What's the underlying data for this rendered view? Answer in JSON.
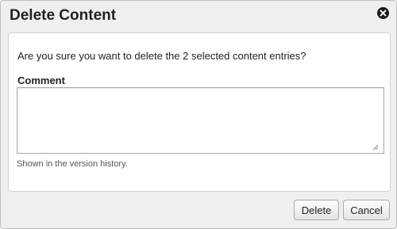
{
  "dialog": {
    "title": "Delete Content",
    "close_icon": "close-circle-icon"
  },
  "body": {
    "question": "Are you sure you want to delete the 2 selected content entries?",
    "comment_label": "Comment",
    "comment_value": "",
    "comment_hint": "Shown in the version history."
  },
  "footer": {
    "delete_label": "Delete",
    "cancel_label": "Cancel"
  }
}
